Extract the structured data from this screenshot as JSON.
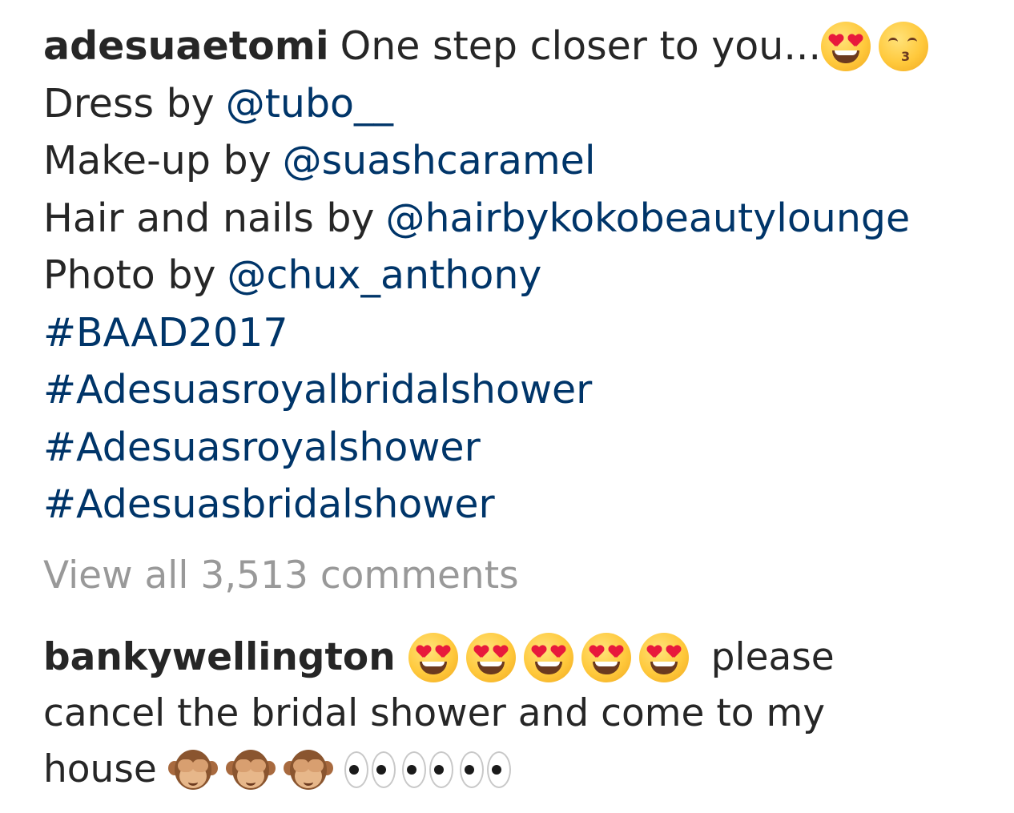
{
  "post": {
    "username": "adesuaetomi",
    "caption_first": "One step closer to you...",
    "caption_emojis": [
      "smiling-face-heart-eyes-icon",
      "kissing-smiling-eyes-icon"
    ],
    "credits": [
      {
        "prefix": "Dress by",
        "mention": "@tubo__"
      },
      {
        "prefix": "Make-up by",
        "mention": "@suashcaramel"
      },
      {
        "prefix": "Hair and nails by",
        "mention": "@hairbykokobeautylounge"
      },
      {
        "prefix": "Photo by",
        "mention": "@chux_anthony"
      }
    ],
    "hashtags": [
      "#BAAD2017",
      "#Adesuasroyalbridalshower",
      "#Adesuasroyalshower",
      "#Adesuasbridalshower"
    ],
    "view_all_comments": "View all 3,513 comments"
  },
  "comment": {
    "username": "bankywellington",
    "text_line1": "please",
    "text_line2": "cancel the bridal shower and come to my",
    "text_line3": "house"
  },
  "colors": {
    "text": "#262626",
    "link": "#003569",
    "muted": "#999999"
  }
}
